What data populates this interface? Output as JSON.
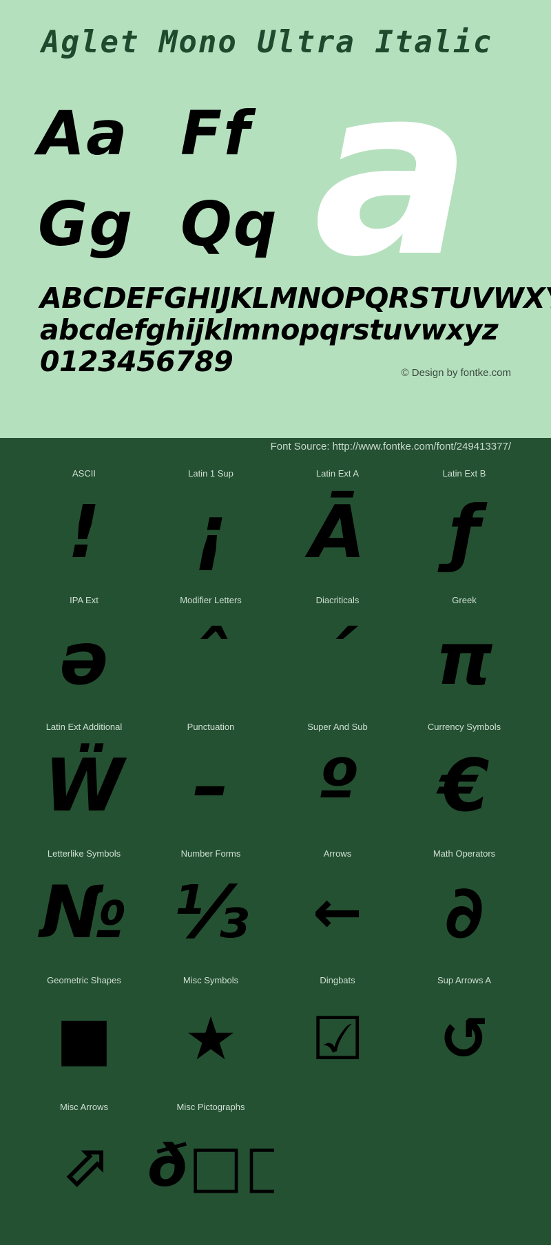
{
  "specimen": {
    "title": "Aglet Mono Ultra Italic",
    "credit": "© Design by fontke.com",
    "source": "Font Source: http://www.fontke.com/font/249413377/",
    "colors": {
      "light_background": "#b5e0be",
      "dark_background": "#245132",
      "title_color": "#1e4a2d",
      "glyph_color": "#000000",
      "big_glyph_color": "#ffffff",
      "label_color": "#cfdfd4"
    },
    "glyph_pairs": [
      "Aa",
      "Ff",
      "Gg",
      "Qq"
    ],
    "feature_glyph": "a",
    "alphabet_lines": [
      "ABCDEFGHIJKLMNOPQRSTUVWXYZ",
      "abcdefghijklmnopqrstuvwxyz",
      "0123456789"
    ]
  },
  "unicode_blocks": [
    [
      {
        "label": "ASCII",
        "glyph": "!",
        "style": "letter"
      },
      {
        "label": "Latin 1 Sup",
        "glyph": "¡",
        "style": "letter"
      },
      {
        "label": "Latin Ext A",
        "glyph": "Ā",
        "style": "letter"
      },
      {
        "label": "Latin Ext B",
        "glyph": "ƒ",
        "style": "letter"
      }
    ],
    [
      {
        "label": "IPA Ext",
        "glyph": "ə",
        "style": "letter"
      },
      {
        "label": "Modifier Letters",
        "glyph": "ˆ",
        "style": "letter"
      },
      {
        "label": "Diacriticals",
        "glyph": "´",
        "style": "letter"
      },
      {
        "label": "Greek",
        "glyph": "π",
        "style": "letter"
      }
    ],
    [
      {
        "label": "Latin Ext Additional",
        "glyph": "Ẅ",
        "style": "letter"
      },
      {
        "label": "Punctuation",
        "glyph": "–",
        "style": "letter"
      },
      {
        "label": "Super And Sub",
        "glyph": "º",
        "style": "letter"
      },
      {
        "label": "Currency Symbols",
        "glyph": "€",
        "style": "letter"
      }
    ],
    [
      {
        "label": "Letterlike Symbols",
        "glyph": "№",
        "style": "letter"
      },
      {
        "label": "Number Forms",
        "glyph": "⅓",
        "style": "letter"
      },
      {
        "label": "Arrows",
        "glyph": "←",
        "style": "sym"
      },
      {
        "label": "Math Operators",
        "glyph": "∂",
        "style": "letter"
      }
    ],
    [
      {
        "label": "Geometric Shapes",
        "glyph": "■",
        "style": "sym"
      },
      {
        "label": "Misc Symbols",
        "glyph": "★",
        "style": "sym"
      },
      {
        "label": "Dingbats",
        "glyph": "☑",
        "style": "sym"
      },
      {
        "label": "Sup Arrows A",
        "glyph": "↺",
        "style": "sym"
      }
    ],
    [
      {
        "label": "Misc Arrows",
        "glyph": "⬀",
        "style": "sym"
      },
      {
        "label": "Misc Pictographs",
        "glyph": "ð□□□",
        "style": "multi"
      },
      {
        "label": "",
        "glyph": "",
        "style": "empty"
      },
      {
        "label": "",
        "glyph": "",
        "style": "empty"
      }
    ]
  ]
}
